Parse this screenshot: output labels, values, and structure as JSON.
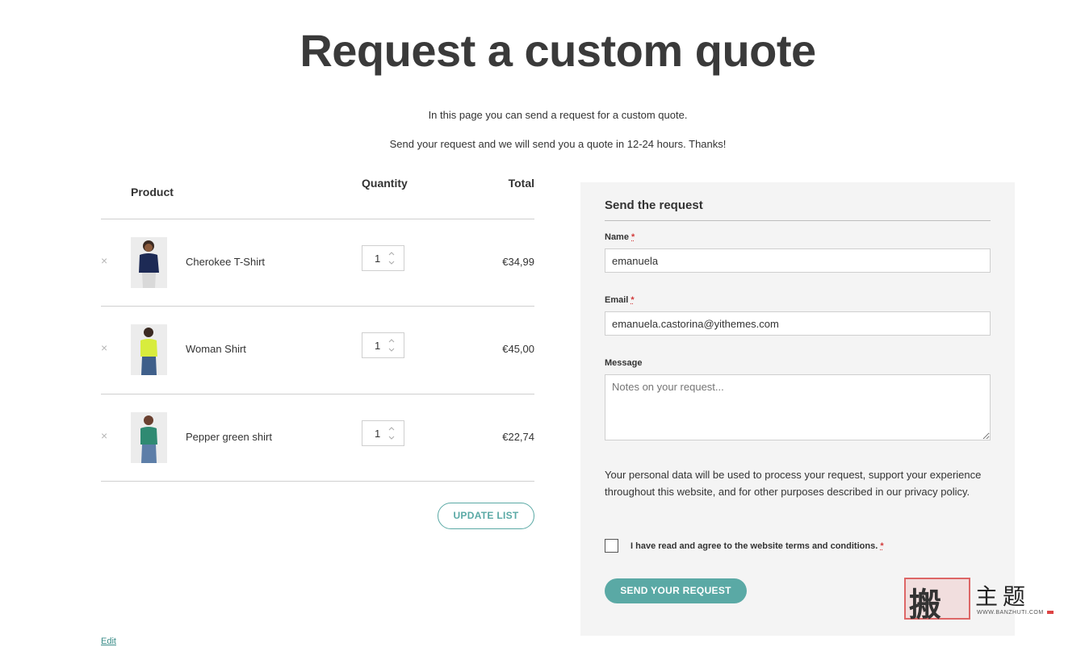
{
  "page": {
    "title": "Request a custom quote",
    "intro_line_1": "In this page you can send a request for a custom quote.",
    "intro_line_2": "Send your request and we will send you a quote in 12-24 hours. Thanks!"
  },
  "quote_table": {
    "headers": {
      "product": "Product",
      "quantity": "Quantity",
      "total": "Total"
    },
    "rows": [
      {
        "name": "Cherokee T-Shirt",
        "quantity": "1",
        "total": "€34,99",
        "shirt_color": "#1d2a55",
        "pants_color": "#d9d9d9"
      },
      {
        "name": "Woman Shirt",
        "quantity": "1",
        "total": "€45,00",
        "shirt_color": "#d8ec3d",
        "pants_color": "#3f5f8a"
      },
      {
        "name": "Pepper green shirt",
        "quantity": "1",
        "total": "€22,74",
        "shirt_color": "#2f8a72",
        "pants_color": "#5d7ea8"
      }
    ],
    "remove_icon": "×",
    "update_button": "UPDATE LIST"
  },
  "form": {
    "title": "Send the request",
    "name_label": "Name",
    "name_value": "emanuela",
    "email_label": "Email",
    "email_value": "emanuela.castorina@yithemes.com",
    "message_label": "Message",
    "message_placeholder": "Notes on your request...",
    "required_mark": "*",
    "privacy_text": "Your personal data will be used to process your request, support your experience throughout this website, and for other purposes described in our privacy policy.",
    "terms_label": "I have read and agree to the website terms and conditions.",
    "submit_button": "SEND YOUR REQUEST"
  },
  "footer": {
    "edit_link": "Edit"
  },
  "watermark": {
    "seal": "搬",
    "brand": "主题",
    "url": "WWW.BANZHUTI.COM"
  },
  "colors": {
    "accent": "#5aa9a5",
    "panel_bg": "#f4f4f4",
    "required": "#d23b3b"
  }
}
